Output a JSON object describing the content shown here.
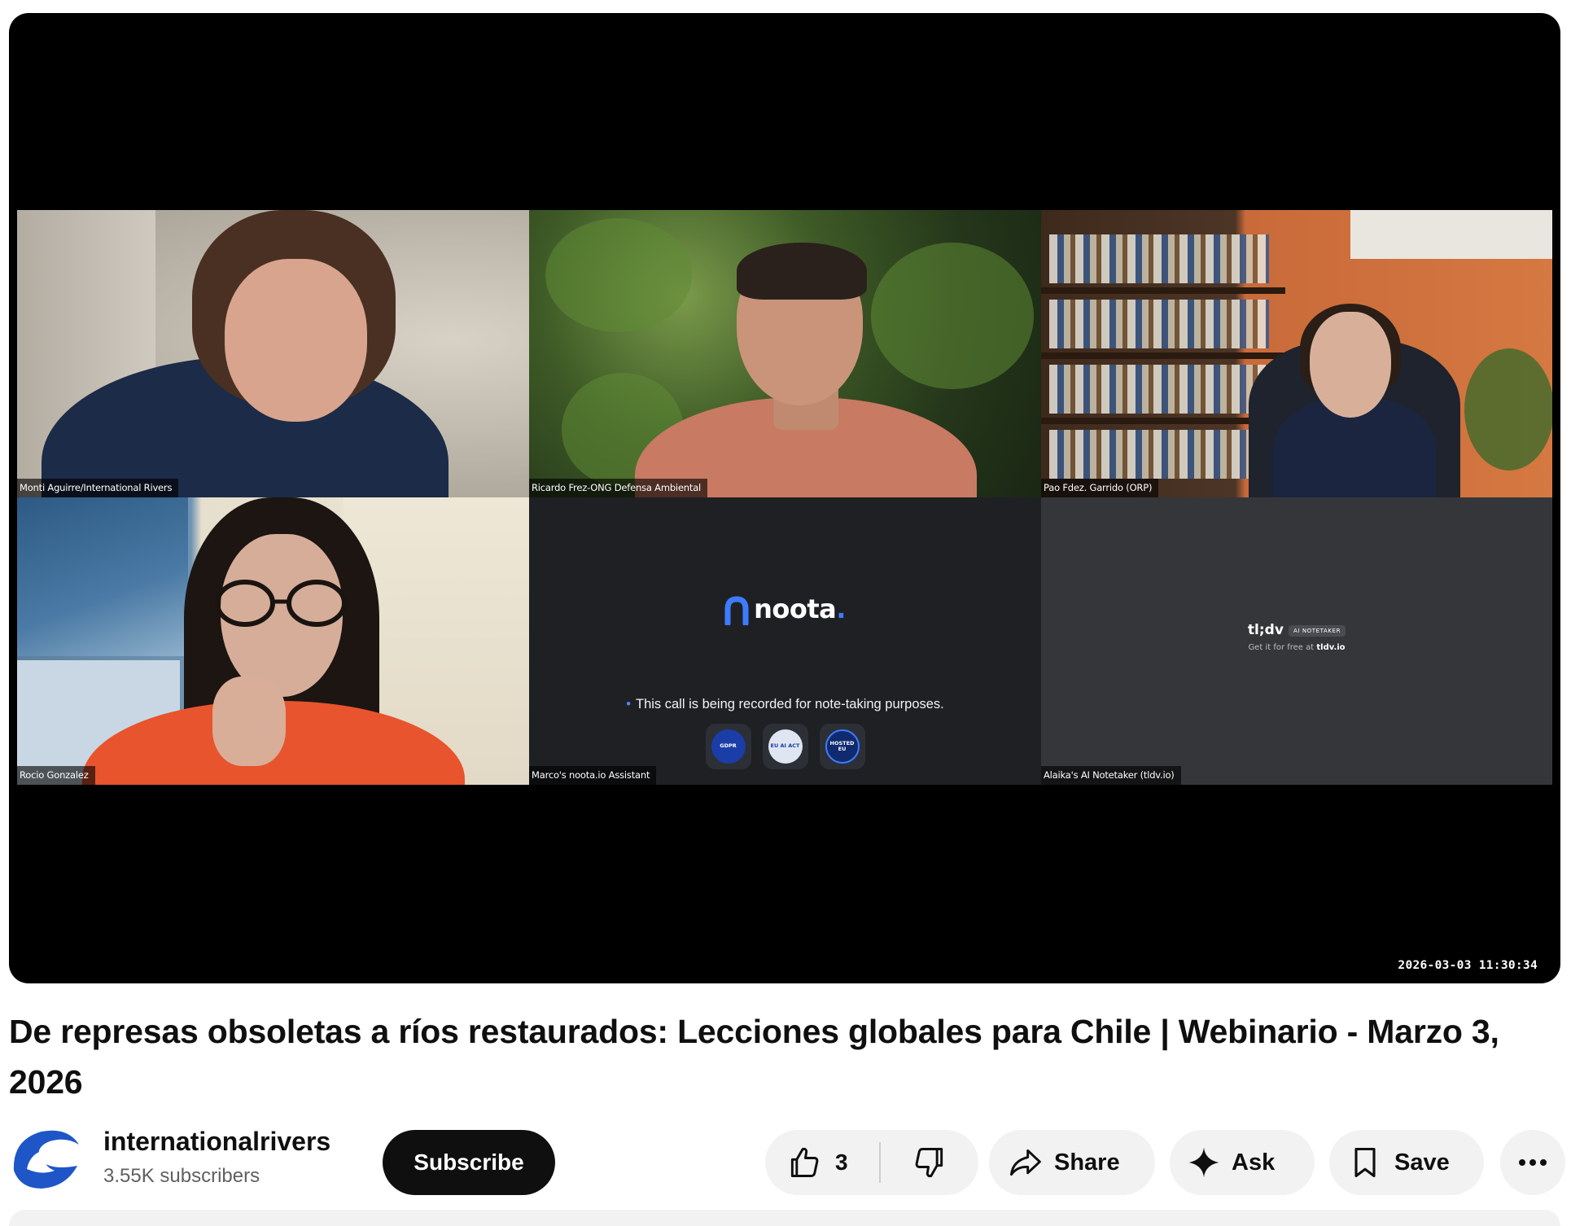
{
  "video": {
    "participants": [
      {
        "label": "Monti Aguirre/International Rivers"
      },
      {
        "label": "Ricardo Frez-ONG Defensa Ambiental"
      },
      {
        "label": "Pao Fdez. Garrido (ORP)"
      },
      {
        "label": "Rocio Gonzalez"
      },
      {
        "label": "Marco's noota.io Assistant"
      },
      {
        "label": "Alaika's AI Notetaker (tldv.io)"
      }
    ],
    "noota": {
      "logo_text": "noota",
      "logo_dot": ".",
      "notice": "This call is being recorded for note-taking purposes.",
      "badges": [
        {
          "text": "GDPR",
          "color": "#1a3da8"
        },
        {
          "text": "EU AI ACT",
          "color": "#dfe6f2"
        },
        {
          "text": "HOSTED EU",
          "color": "#0f2a6e"
        }
      ]
    },
    "tldv": {
      "logo": "tl;dv",
      "tag": "AI NOTETAKER",
      "sub_prefix": "Get it for free at",
      "sub_link": "tldv.io"
    },
    "timestamp": "2026-03-03  11:30:34"
  },
  "title": "De represas obsoletas a ríos restaurados: Lecciones globales para Chile | Webinario - Marzo 3, 2026",
  "channel": {
    "name": "internationalrivers",
    "subscribers": "3.55K subscribers",
    "subscribe_label": "Subscribe"
  },
  "actions": {
    "like_count": "3",
    "share_label": "Share",
    "ask_label": "Ask",
    "save_label": "Save"
  },
  "colors": {
    "brand_blue": "#1e56c8",
    "accent_blue": "#3d7bff"
  }
}
